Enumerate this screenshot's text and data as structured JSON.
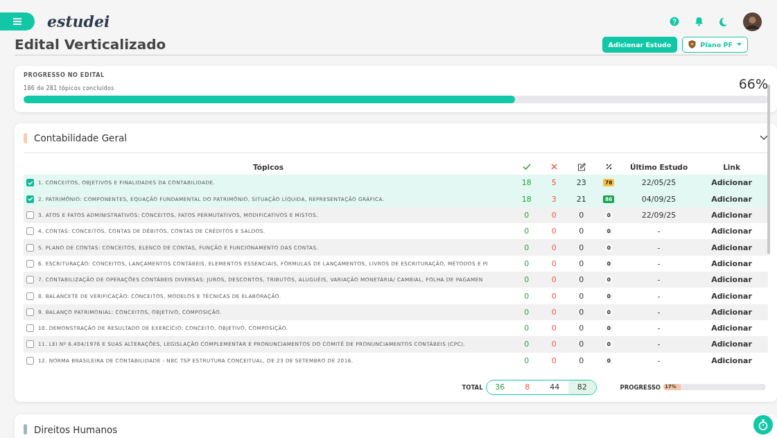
{
  "header": {
    "logo": "estudei"
  },
  "page": {
    "title": "Edital Verticalizado",
    "add_button": "Adicionar Estudo",
    "plan_button": "Plano PF"
  },
  "progress": {
    "label": "PROGRESSO NO EDITAL",
    "subtitle": "186 de 281 tópicos concluídos",
    "percent": "66%",
    "level": 0.66
  },
  "subject": {
    "name": "Contabilidade Geral",
    "color": "#f8cdb4",
    "expanded": true,
    "columns": {
      "topics": "Tópicos",
      "last_study": "Último Estudo",
      "link": "Link"
    },
    "rows": [
      {
        "topic": "1. CONCEITOS, OBJETIVOS E FINALIDADES DA CONTABILIDADE.",
        "checked": true,
        "correct": "18",
        "wrong": "5",
        "total": "23",
        "percent": "78",
        "color": "#f6c344",
        "last": "22/05/25",
        "link": "Adicionar"
      },
      {
        "topic": "2. PATRIMÔNIO: COMPONENTES, EQUAÇÃO FUNDAMENTAL DO PATRIMÔNIO, SITUAÇÃO LÍQUIDA, REPRESENTAÇÃO GRÁFICA.",
        "checked": true,
        "correct": "18",
        "wrong": "3",
        "total": "21",
        "percent": "86",
        "color": "#17a14f",
        "last": "04/09/25",
        "link": "Adicionar"
      },
      {
        "topic": "3. ATOS E FATOS ADMINISTRATIVOS: CONCEITOS, FATOS PERMUTATIVOS, MODIFICATIVOS E MISTOS.",
        "checked": false,
        "correct": "0",
        "wrong": "0",
        "total": "0",
        "percent": "0",
        "color": "#f7f7f7",
        "last": "22/09/25",
        "link": "Adicionar"
      },
      {
        "topic": "4. CONTAS: CONCEITOS, CONTAS DE DÉBITOS, CONTAS DE CRÉDITOS E SALDOS.",
        "checked": false,
        "correct": "0",
        "wrong": "0",
        "total": "0",
        "percent": "0",
        "color": "#f7f7f7",
        "last": "-",
        "link": "Adicionar"
      },
      {
        "topic": "5. PLANO DE CONTAS: CONCEITOS, ELENCO DE CONTAS, FUNÇÃO E FUNCIONAMENTO DAS CONTAS.",
        "checked": false,
        "correct": "0",
        "wrong": "0",
        "total": "0",
        "percent": "0",
        "color": "#f7f7f7",
        "last": "-",
        "link": "Adicionar"
      },
      {
        "topic": "6. ESCRITURAÇÃO: CONCEITOS, LANÇAMENTOS CONTÁBEIS, ELEMENTOS ESSENCIAIS, FÓRMULAS DE LANÇAMENTOS, LIVROS DE ESCRITURAÇÃO, MÉTODOS E PI",
        "checked": false,
        "correct": "0",
        "wrong": "0",
        "total": "0",
        "percent": "0",
        "color": "#f7f7f7",
        "last": "-",
        "link": "Adicionar"
      },
      {
        "topic": "7. CONTABILIZAÇÃO DE OPERAÇÕES CONTÁBEIS DIVERSAS: JUROS, DESCONTOS, TRIBUTOS, ALUGUÉIS, VARIAÇÃO MONETÁRIA/ CAMBIAL, FOLHA DE PAGAMEN",
        "checked": false,
        "correct": "0",
        "wrong": "0",
        "total": "0",
        "percent": "0",
        "color": "#f7f7f7",
        "last": "-",
        "link": "Adicionar"
      },
      {
        "topic": "8. BALANCETE DE VERIFICAÇÃO: CONCEITOS, MODELOS E TÉCNICAS DE ELABORAÇÃO.",
        "checked": false,
        "correct": "0",
        "wrong": "0",
        "total": "0",
        "percent": "0",
        "color": "#f7f7f7",
        "last": "-",
        "link": "Adicionar"
      },
      {
        "topic": "9. BALANÇO PATRIMONIAL: CONCEITOS, OBJETIVO, COMPOSIÇÃO.",
        "checked": false,
        "correct": "0",
        "wrong": "0",
        "total": "0",
        "percent": "0",
        "color": "#f7f7f7",
        "last": "-",
        "link": "Adicionar"
      },
      {
        "topic": "10. DEMONSTRAÇÃO DE RESULTADO DE EXERCÍCIO: CONCEITO, OBJETIVO, COMPOSIÇÃO.",
        "checked": false,
        "correct": "0",
        "wrong": "0",
        "total": "0",
        "percent": "0",
        "color": "#f7f7f7",
        "last": "-",
        "link": "Adicionar"
      },
      {
        "topic": "11. LEI Nº 6.404/1976 E SUAS ALTERAÇÕES, LEGISLAÇÃO COMPLEMENTAR E PRONUNCIAMENTOS DO COMITÊ DE PRONUNCIAMENTOS CONTÁBEIS (CPC).",
        "checked": false,
        "correct": "0",
        "wrong": "0",
        "total": "0",
        "percent": "0",
        "color": "#f7f7f7",
        "last": "-",
        "link": "Adicionar"
      },
      {
        "topic": "12. NORMA BRASILEIRA DE CONTABILIDADE - NBC TSP ESTRUTURA CONCEITUAL, DE 23 DE SETEMBRO DE 2016.",
        "checked": false,
        "correct": "0",
        "wrong": "0",
        "total": "0",
        "percent": "0",
        "color": "#f7f7f7",
        "last": "-",
        "link": "Adicionar"
      }
    ],
    "totals": {
      "label": "TOTAL",
      "correct": "36",
      "wrong": "8",
      "total": "44",
      "percent": "82"
    },
    "progress": {
      "label": "PROGRESSO",
      "percent": "17%",
      "level": 0.17
    }
  },
  "next_subject": {
    "name": "Direitos Humanos",
    "color": "#9fb3bd"
  }
}
